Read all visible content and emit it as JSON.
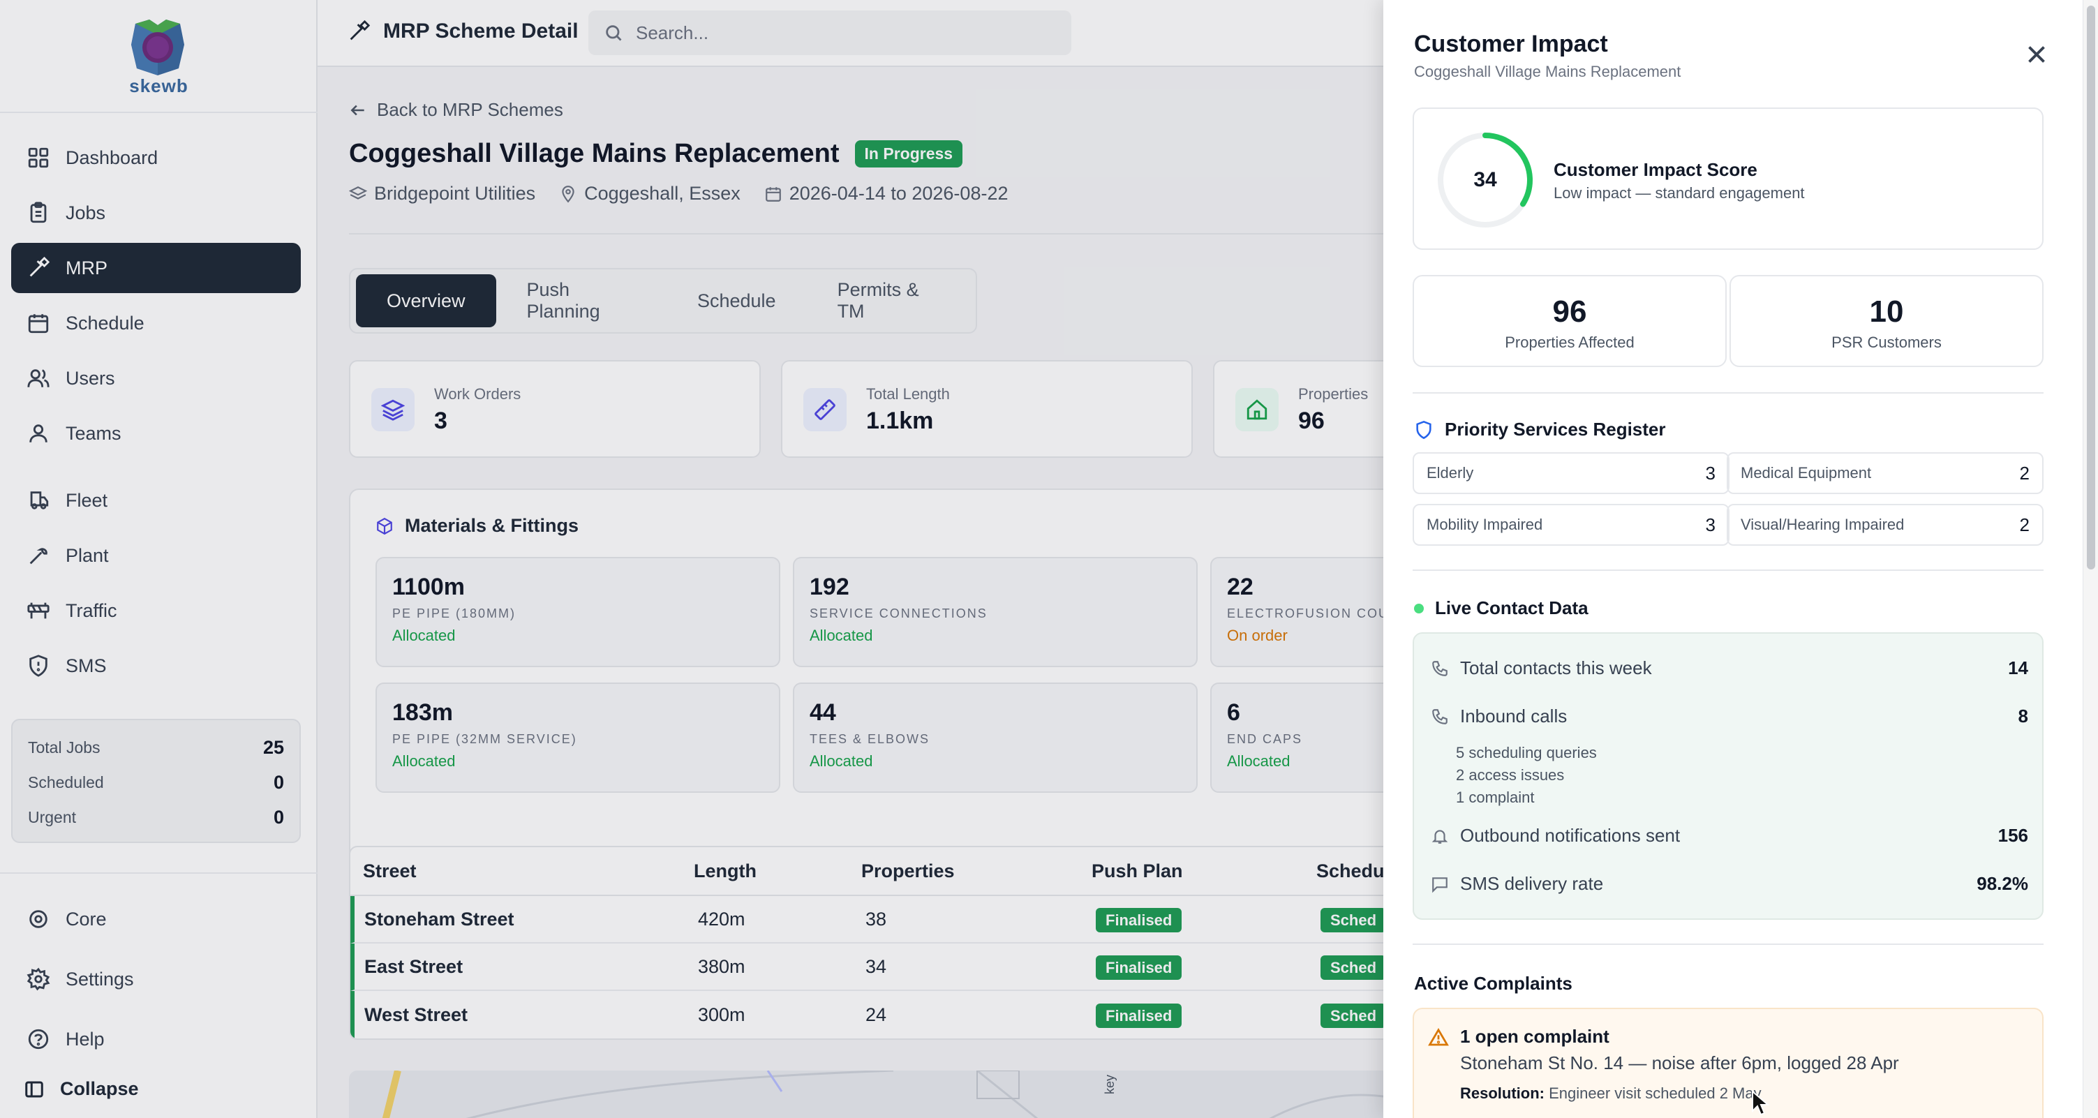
{
  "sidebar": {
    "logo_text": "skewb",
    "nav": [
      {
        "label": "Dashboard",
        "icon": "dashboard-icon"
      },
      {
        "label": "Jobs",
        "icon": "clipboard-icon"
      },
      {
        "label": "MRP",
        "icon": "hammer-icon",
        "active": true
      },
      {
        "label": "Schedule",
        "icon": "calendar-icon"
      },
      {
        "label": "Users",
        "icon": "users-icon"
      },
      {
        "label": "Teams",
        "icon": "team-icon"
      },
      {
        "label": "Fleet",
        "icon": "truck-icon"
      },
      {
        "label": "Plant",
        "icon": "wrench-icon"
      },
      {
        "label": "Traffic",
        "icon": "traffic-barrier-icon"
      },
      {
        "label": "SMS",
        "icon": "shield-alert-icon"
      }
    ],
    "stats": [
      {
        "label": "Total Jobs",
        "value": "25"
      },
      {
        "label": "Scheduled",
        "value": "0"
      },
      {
        "label": "Urgent",
        "value": "0"
      }
    ],
    "bottom_nav": [
      {
        "label": "Core",
        "icon": "settings-cog-icon"
      },
      {
        "label": "Settings",
        "icon": "gear-icon"
      },
      {
        "label": "Help",
        "icon": "help-circle-icon"
      }
    ],
    "collapse_label": "Collapse"
  },
  "topbar": {
    "title": "MRP Scheme Detail",
    "search_placeholder": "Search..."
  },
  "scheme": {
    "back_label": "Back to MRP Schemes",
    "title": "Coggeshall Village Mains Replacement",
    "status": "In Progress",
    "client": "Bridgepoint Utilities",
    "location": "Coggeshall, Essex",
    "dates": "2026-04-14 to 2026-08-22"
  },
  "tabs": [
    "Overview",
    "Push Planning",
    "Schedule",
    "Permits & TM"
  ],
  "kpis": [
    {
      "label": "Work Orders",
      "value": "3"
    },
    {
      "label": "Total Length",
      "value": "1.1km"
    },
    {
      "label": "Properties",
      "value": "96"
    }
  ],
  "materials": {
    "title": "Materials & Fittings",
    "items": [
      {
        "value": "1100m",
        "label": "PE PIPE (180MM)",
        "status": "Allocated"
      },
      {
        "value": "192",
        "label": "SERVICE CONNECTIONS",
        "status": "Allocated"
      },
      {
        "value": "22",
        "label": "ELECTROFUSION COUP",
        "status": "On order"
      },
      {
        "value": "183m",
        "label": "PE PIPE (32MM SERVICE)",
        "status": "Allocated"
      },
      {
        "value": "44",
        "label": "TEES & ELBOWS",
        "status": "Allocated"
      },
      {
        "value": "6",
        "label": "END CAPS",
        "status": "Allocated"
      }
    ]
  },
  "streets_table": {
    "headers": [
      "Street",
      "Length",
      "Properties",
      "Push Plan",
      "Schedu"
    ],
    "rows": [
      {
        "street": "Stoneham Street",
        "length": "420m",
        "properties": "38",
        "push_plan": "Finalised",
        "schedule": "Sched"
      },
      {
        "street": "East Street",
        "length": "380m",
        "properties": "34",
        "push_plan": "Finalised",
        "schedule": "Sched"
      },
      {
        "street": "West Street",
        "length": "300m",
        "properties": "24",
        "push_plan": "Finalised",
        "schedule": "Sched"
      }
    ]
  },
  "map_label": "key",
  "drawer": {
    "title": "Customer Impact",
    "subtitle": "Coggeshall Village Mains Replacement",
    "score": {
      "value": "34",
      "fraction": 0.34,
      "title": "Customer Impact Score",
      "description": "Low impact — standard engagement",
      "color": "#22c55e"
    },
    "properties_affected": {
      "value": "96",
      "label": "Properties Affected"
    },
    "psr_customers": {
      "value": "10",
      "label": "PSR Customers"
    },
    "psr": {
      "title": "Priority Services Register",
      "items": [
        {
          "label": "Elderly",
          "value": "3"
        },
        {
          "label": "Medical Equipment",
          "value": "2"
        },
        {
          "label": "Mobility Impaired",
          "value": "3"
        },
        {
          "label": "Visual/Hearing Impaired",
          "value": "2"
        }
      ]
    },
    "contact": {
      "title": "Live Contact Data",
      "total_label": "Total contacts this week",
      "total_value": "14",
      "inbound_label": "Inbound calls",
      "inbound_value": "8",
      "inbound_breakdown": [
        "5 scheduling queries",
        "2 access issues",
        "1 complaint"
      ],
      "outbound_label": "Outbound notifications sent",
      "outbound_value": "156",
      "sms_label": "SMS delivery rate",
      "sms_value": "98.2%"
    },
    "complaints": {
      "title": "Active Complaints",
      "headline": "1 open complaint",
      "detail": "Stoneham St No. 14 — noise after 6pm, logged 28 Apr",
      "resolution_label": "Resolution:",
      "resolution_text": "Engineer visit scheduled 2 May"
    }
  }
}
